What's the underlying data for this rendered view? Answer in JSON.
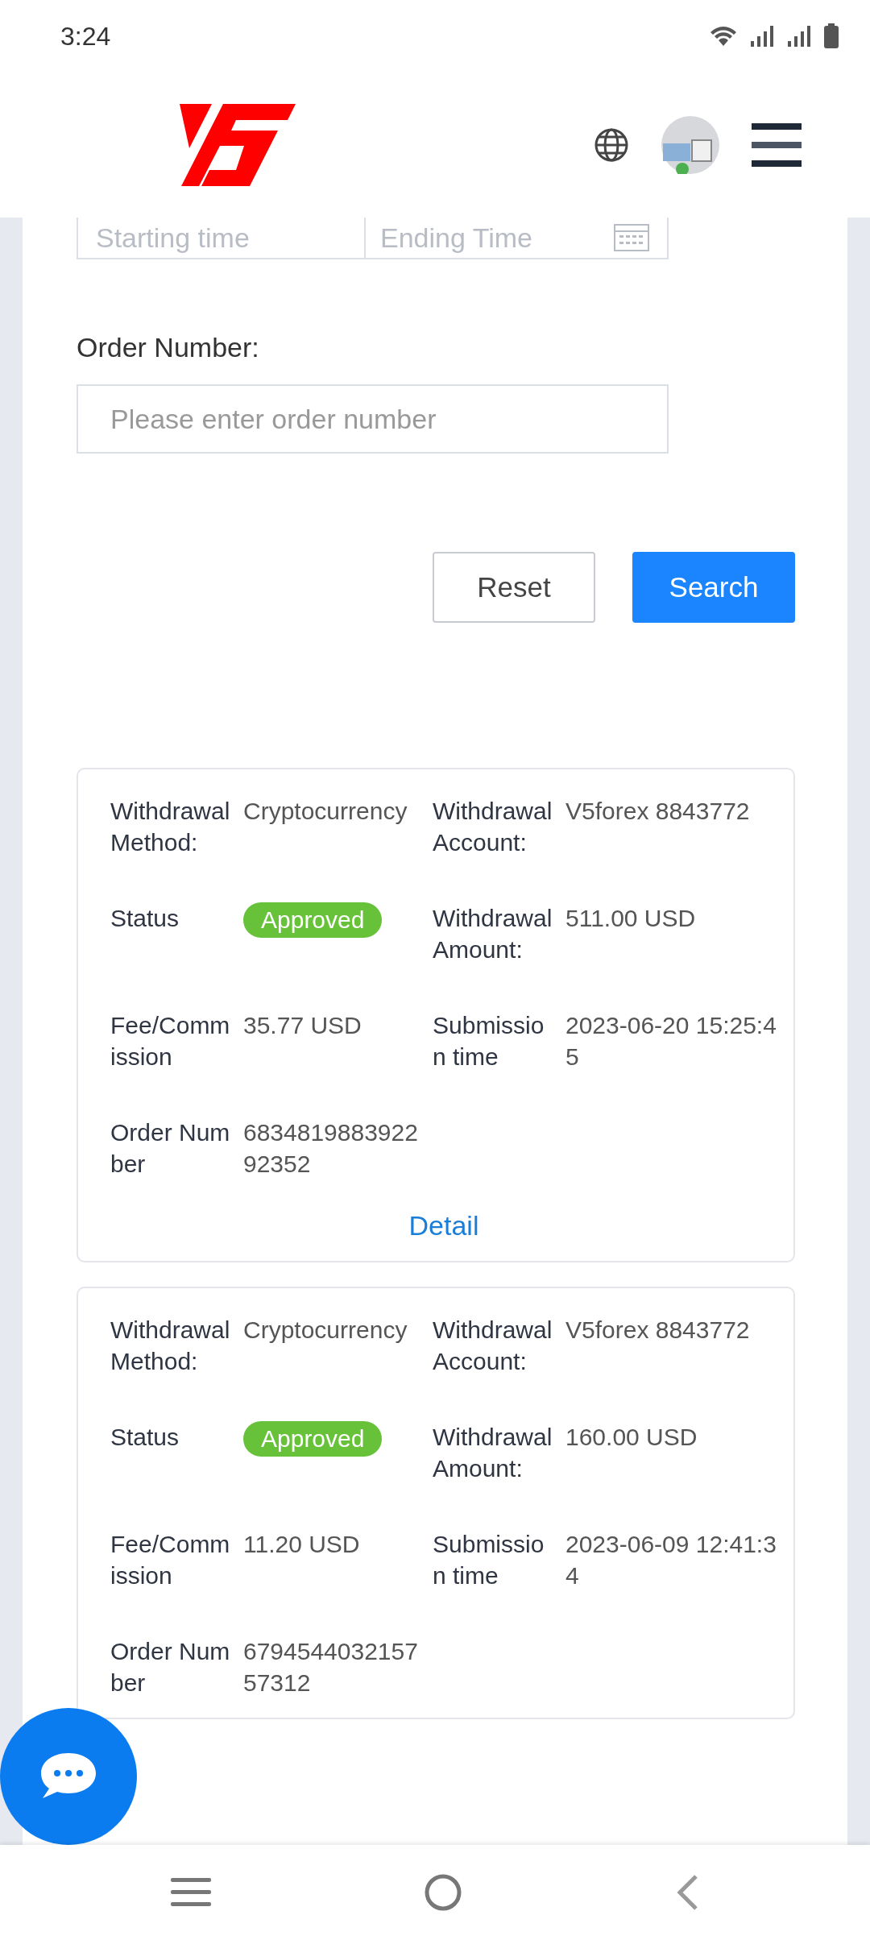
{
  "status_bar": {
    "time": "3:24"
  },
  "filters": {
    "start_placeholder": "Starting time",
    "end_placeholder": "Ending Time",
    "order_label": "Order Number:",
    "order_placeholder": "Please enter order number"
  },
  "buttons": [
    {
      "label": "Reset",
      "kind": "plain"
    },
    {
      "label": "Search",
      "kind": "primary"
    }
  ],
  "records": [
    {
      "fields": [
        {
          "label": "Withdrawal Method:",
          "value": "Cryptocurrency",
          "kind": "text"
        },
        {
          "label": "Withdrawal Account:",
          "value": "V5forex 8843772",
          "kind": "text"
        },
        {
          "label": "Status",
          "value": "Approved",
          "kind": "status",
          "color": "#67c23a"
        },
        {
          "label": "Withdrawal Amount:",
          "value": "511.00 USD",
          "kind": "text"
        },
        {
          "label": "Fee/Commission",
          "value": "35.77 USD",
          "kind": "text"
        },
        {
          "label": "Submission time",
          "value": "2023-06-20 15:25:45",
          "kind": "text"
        },
        {
          "label": "Order Number",
          "value": "683481988392292352",
          "kind": "text"
        }
      ],
      "detail": "Detail"
    },
    {
      "fields": [
        {
          "label": "Withdrawal Method:",
          "value": "Cryptocurrency",
          "kind": "text"
        },
        {
          "label": "Withdrawal Account:",
          "value": "V5forex 8843772",
          "kind": "text"
        },
        {
          "label": "Status",
          "value": "Approved",
          "kind": "status",
          "color": "#67c23a"
        },
        {
          "label": "Withdrawal Amount:",
          "value": "160.00 USD",
          "kind": "text"
        },
        {
          "label": "Fee/Commission",
          "value": "11.20 USD",
          "kind": "text"
        },
        {
          "label": "Submission time",
          "value": "2023-06-09 12:41:34",
          "kind": "text"
        },
        {
          "label": "Order Number",
          "value": "679454403215757312",
          "kind": "text"
        }
      ]
    }
  ]
}
